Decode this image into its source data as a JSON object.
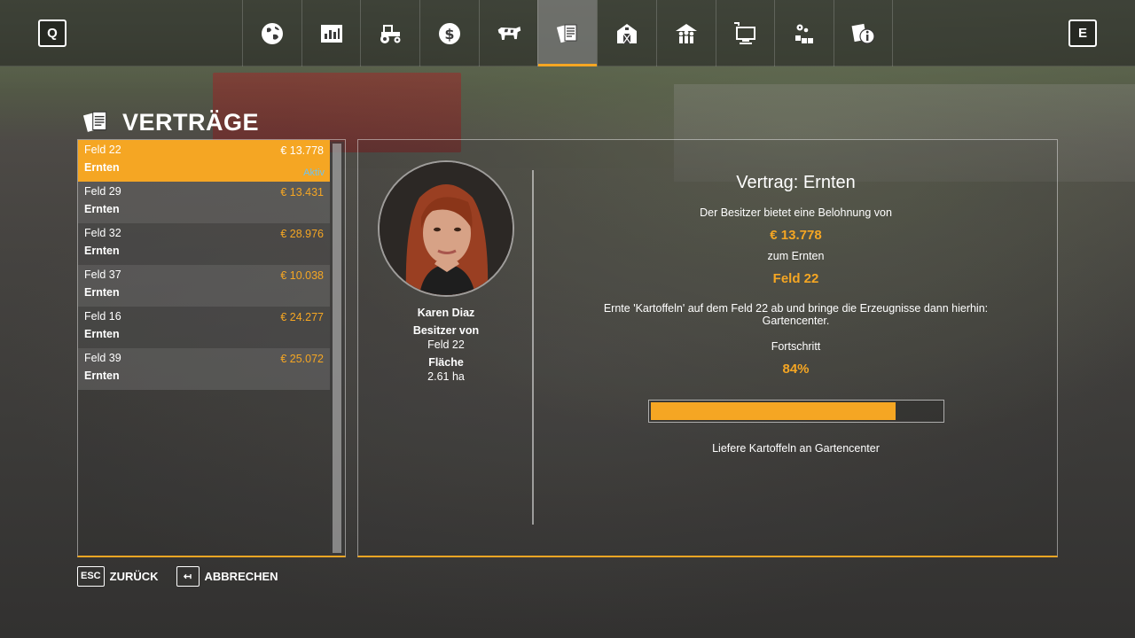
{
  "topbar": {
    "left_key": "Q",
    "right_key": "E",
    "tabs": [
      {
        "icon": "globe-icon"
      },
      {
        "icon": "statistics-icon"
      },
      {
        "icon": "tractor-icon"
      },
      {
        "icon": "money-icon"
      },
      {
        "icon": "cow-icon"
      },
      {
        "icon": "contracts-icon",
        "active": true
      },
      {
        "icon": "barn-icon"
      },
      {
        "icon": "farmers-icon"
      },
      {
        "icon": "monitor-icon"
      },
      {
        "icon": "production-icon"
      },
      {
        "icon": "help-icon"
      }
    ]
  },
  "page": {
    "title": "VERTRÄGE"
  },
  "contracts": [
    {
      "field": "Feld 22",
      "reward": "€ 13.778",
      "type": "Ernten",
      "status": "Aktiv",
      "active": true
    },
    {
      "field": "Feld 29",
      "reward": "€ 13.431",
      "type": "Ernten"
    },
    {
      "field": "Feld 32",
      "reward": "€ 28.976",
      "type": "Ernten"
    },
    {
      "field": "Feld 37",
      "reward": "€ 10.038",
      "type": "Ernten"
    },
    {
      "field": "Feld 16",
      "reward": "€ 24.277",
      "type": "Ernten"
    },
    {
      "field": "Feld 39",
      "reward": "€ 25.072",
      "type": "Ernten"
    }
  ],
  "owner": {
    "name": "Karen Diaz",
    "owner_of_label": "Besitzer von",
    "owner_of_value": "Feld 22",
    "area_label": "Fläche",
    "area_value": "2.61 ha"
  },
  "detail": {
    "title": "Vertrag: Ernten",
    "offer_text": "Der Besitzer bietet eine Belohnung von",
    "reward": "€ 13.778",
    "for_text": "zum Ernten",
    "field": "Feld 22",
    "description": "Ernte 'Kartoffeln' auf dem Feld 22 ab und bringe die Erzeugnisse dann hierhin: Gartencenter.",
    "progress_label": "Fortschritt",
    "progress_text": "84%",
    "progress_value": 0.84,
    "deliver_text": "Liefere Kartoffeln an Gartencenter"
  },
  "footer": {
    "back_key": "ESC",
    "back_label": "ZURÜCK",
    "cancel_key": "↤",
    "cancel_label": "ABBRECHEN"
  },
  "colors": {
    "accent": "#f5a623",
    "status": "#6fc3ee"
  }
}
